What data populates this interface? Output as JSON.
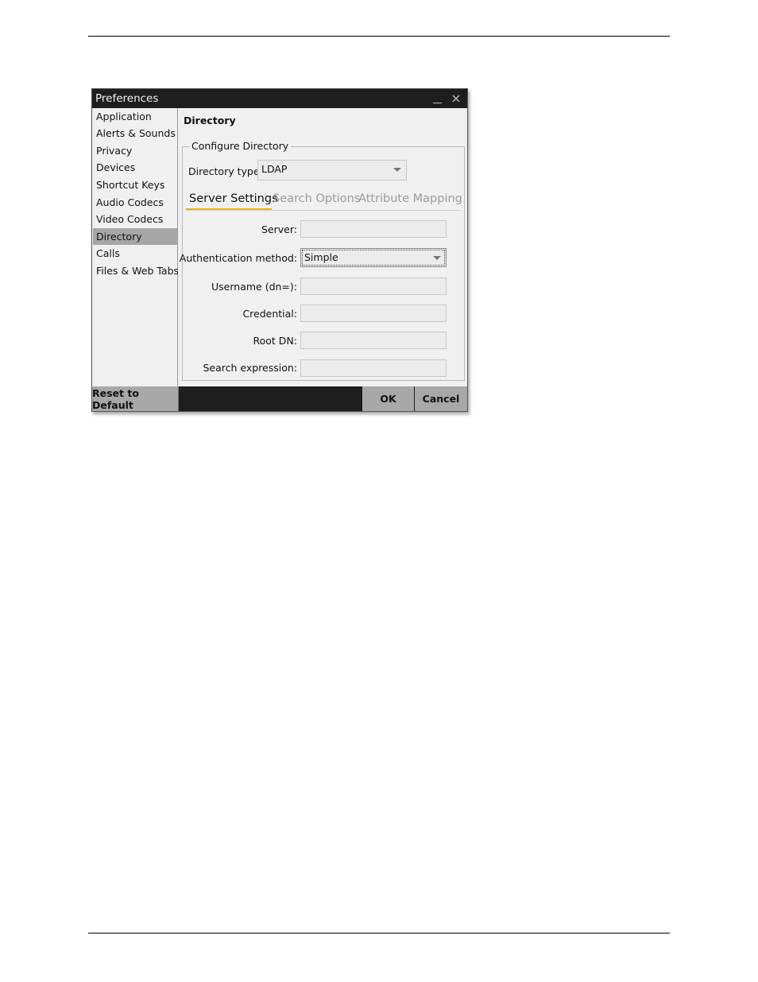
{
  "window": {
    "title": "Preferences",
    "minimize_glyph": "minimize-icon",
    "close_glyph": "×"
  },
  "sidebar": {
    "items": [
      {
        "label": "Application"
      },
      {
        "label": "Alerts & Sounds"
      },
      {
        "label": "Privacy"
      },
      {
        "label": "Devices"
      },
      {
        "label": "Shortcut Keys"
      },
      {
        "label": "Audio Codecs"
      },
      {
        "label": "Video Codecs"
      },
      {
        "label": "Directory",
        "selected": true
      },
      {
        "label": "Calls"
      },
      {
        "label": "Files & Web Tabs"
      }
    ]
  },
  "content": {
    "title": "Directory",
    "group_title": "Configure Directory",
    "directory_type": {
      "label": "Directory type:",
      "value": "LDAP"
    },
    "tabs": [
      {
        "label": "Server Settings",
        "active": true
      },
      {
        "label": "Search Options",
        "active": false
      },
      {
        "label": "Attribute Mapping",
        "active": false
      }
    ],
    "fields": {
      "server": {
        "label": "Server:",
        "value": ""
      },
      "auth_method": {
        "label": "Authentication method:",
        "value": "Simple"
      },
      "username": {
        "label": "Username (dn=):",
        "value": ""
      },
      "credential": {
        "label": "Credential:",
        "value": ""
      },
      "root_dn": {
        "label": "Root DN:",
        "value": ""
      },
      "search_expression": {
        "label": "Search expression:",
        "value": ""
      }
    }
  },
  "footer": {
    "reset_label": "Reset to Default",
    "ok_label": "OK",
    "cancel_label": "Cancel"
  },
  "colors": {
    "titlebar": "#1e1e1e",
    "selected_item": "#a6a6a6",
    "tab_accent": "#f0b400",
    "button": "#a8a8a8"
  }
}
